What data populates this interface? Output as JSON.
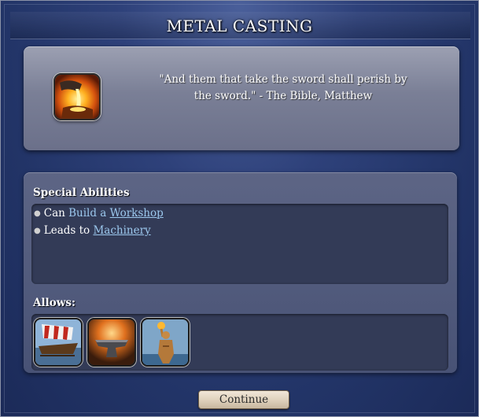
{
  "title": "METAL CASTING",
  "quote": "\"And them that take the sword shall perish by the sword.\" - The Bible, Matthew",
  "tech_icon": "molten-metal-pour-icon",
  "special_abilities": {
    "label": "Special Abilities",
    "items": [
      {
        "prefix": "Can",
        "action": "Build a",
        "target": "Workshop"
      },
      {
        "prefix": "Leads to",
        "action": "",
        "target": "Machinery"
      }
    ]
  },
  "allows": {
    "label": "Allows:",
    "items": [
      {
        "icon": "galley-ship-icon"
      },
      {
        "icon": "anvil-forge-icon"
      },
      {
        "icon": "colossus-statue-icon"
      }
    ]
  },
  "continue_label": "Continue",
  "colors": {
    "link": "#9cc8ee",
    "panel_light": "#8a8fa6",
    "panel_dark": "#333b57",
    "background": "#26386e",
    "button": "#e0d2bd"
  }
}
